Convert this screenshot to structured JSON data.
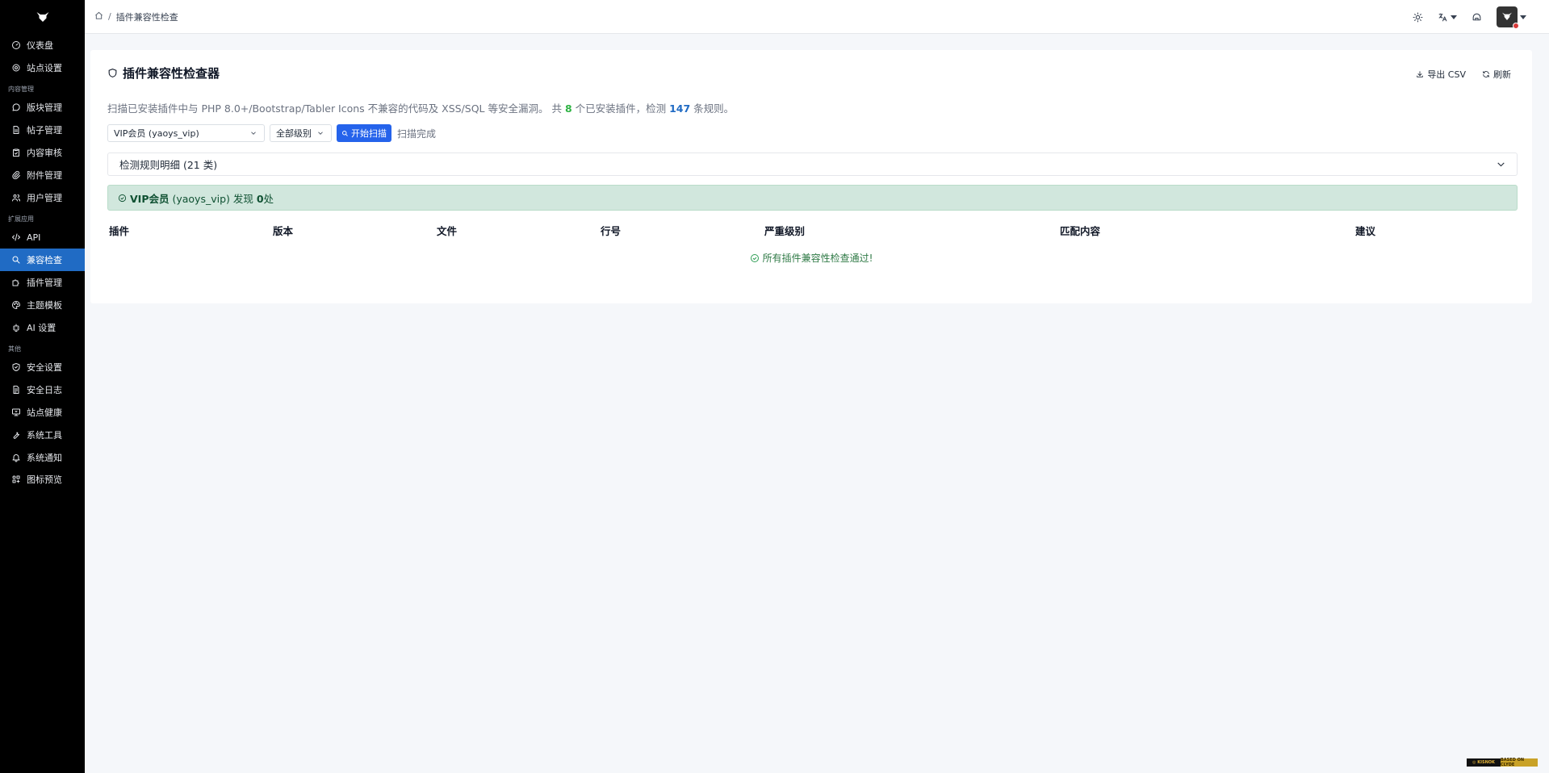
{
  "sidebar": {
    "items": [
      {
        "label": "仪表盘",
        "icon": "gauge-icon"
      },
      {
        "label": "站点设置",
        "icon": "settings-icon"
      },
      {
        "section": "内容管理"
      },
      {
        "label": "版块管理",
        "icon": "message-circle-icon"
      },
      {
        "label": "帖子管理",
        "icon": "file-text-icon"
      },
      {
        "label": "内容审核",
        "icon": "clipboard-check-icon"
      },
      {
        "label": "附件管理",
        "icon": "paperclip-icon"
      },
      {
        "label": "用户管理",
        "icon": "users-icon"
      },
      {
        "section": "扩展应用"
      },
      {
        "label": "API",
        "icon": "code-icon"
      },
      {
        "label": "兼容检查",
        "icon": "search-icon",
        "active": true
      },
      {
        "label": "插件管理",
        "icon": "puzzle-icon"
      },
      {
        "label": "主题模板",
        "icon": "palette-icon"
      },
      {
        "label": "AI 设置",
        "icon": "robot-icon"
      },
      {
        "section": "其他"
      },
      {
        "label": "安全设置",
        "icon": "shield-check-icon"
      },
      {
        "label": "安全日志",
        "icon": "file-log-icon"
      },
      {
        "label": "站点健康",
        "icon": "device-heart-icon"
      },
      {
        "label": "系统工具",
        "icon": "tool-icon"
      },
      {
        "label": "系统通知",
        "icon": "bell-icon"
      },
      {
        "label": "图标预览",
        "icon": "icons-icon"
      }
    ]
  },
  "topbar": {
    "breadcrumb_sep": "/",
    "breadcrumb_current": "插件兼容性检查"
  },
  "card": {
    "title": "插件兼容性检查器",
    "export_label": "导出 CSV",
    "refresh_label": "刷新",
    "desc_prefix": "扫描已安装插件中与 PHP 8.0+/Bootstrap/Tabler Icons 不兼容的代码及 XSS/SQL 等安全漏洞。 共 ",
    "plugin_count": "8",
    "desc_middle": " 个已安装插件，检测 ",
    "rule_count": "147",
    "desc_suffix": " 条规则。"
  },
  "controls": {
    "plugin_select": "VIP会员 (yaoys_vip)",
    "level_select": "全部级别",
    "scan_button": "开始扫描",
    "scan_status": "扫描完成"
  },
  "accordion": {
    "label": "检测规则明细 (21 类)"
  },
  "alert": {
    "plugin_name": "VIP会员",
    "plugin_id": " (yaoys_vip) 发现 ",
    "count": "0",
    "unit": "处"
  },
  "table": {
    "headers": [
      "插件",
      "版本",
      "文件",
      "行号",
      "严重级别",
      "匹配内容",
      "建议"
    ],
    "empty_message": "所有插件兼容性检查通过!"
  },
  "watermark": {
    "left": "◎ KISNOK",
    "right": "BASED ON CLYDE"
  },
  "colors": {
    "sidebar_bg": "#000000",
    "active": "#206bc4",
    "primary_button": "#2563eb",
    "success_bg": "#d1e7dd",
    "success_text": "#0f5132"
  }
}
